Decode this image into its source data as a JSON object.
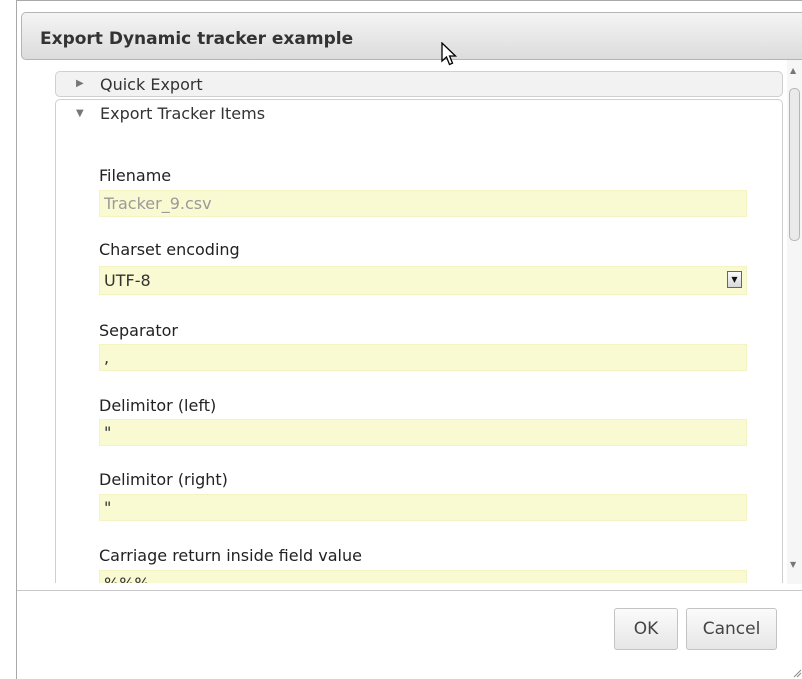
{
  "dialog": {
    "title": "Export Dynamic tracker example",
    "close_symbol": "✖"
  },
  "accordion": {
    "quick_export": {
      "label": "Quick Export",
      "arrow": "▶"
    },
    "tracker_items": {
      "label": "Export Tracker Items",
      "arrow": "▼"
    }
  },
  "form": {
    "filename": {
      "label": "Filename",
      "placeholder": "Tracker_9.csv"
    },
    "charset": {
      "label": "Charset encoding",
      "value": "UTF-8",
      "arrow": "▼"
    },
    "separator": {
      "label": "Separator",
      "value": ","
    },
    "delim_left": {
      "label": "Delimitor (left)",
      "value": "\""
    },
    "delim_right": {
      "label": "Delimitor (right)",
      "value": "\""
    },
    "carriage_return": {
      "label": "Carriage return inside field value",
      "value": "%%%"
    }
  },
  "scrollbar": {
    "up": "▲",
    "down": "▼"
  },
  "footer": {
    "ok_label": "OK",
    "cancel_label": "Cancel"
  },
  "icons": {
    "close": "close-icon",
    "cursor": "mouse-cursor-icon",
    "resize": "resize-grip-icon"
  }
}
